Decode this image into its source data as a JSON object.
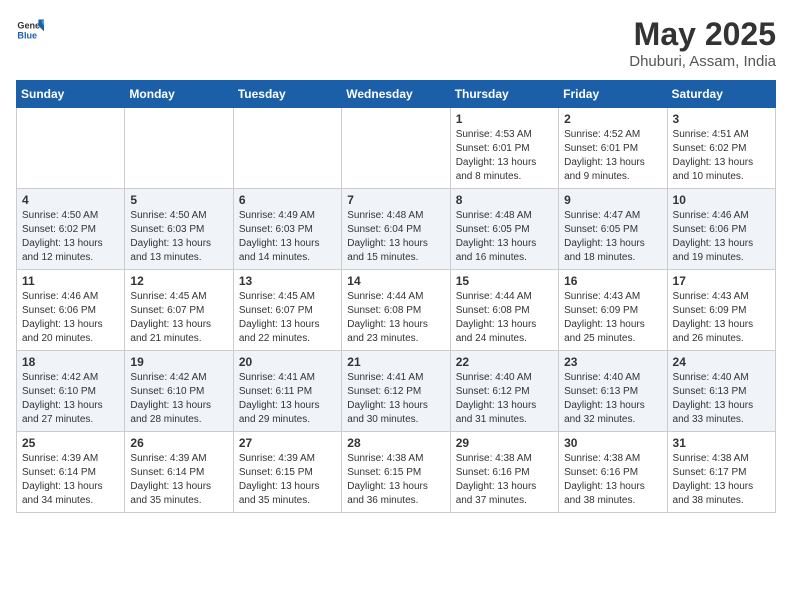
{
  "logo": {
    "general": "General",
    "blue": "Blue"
  },
  "header": {
    "month_year": "May 2025",
    "location": "Dhuburi, Assam, India"
  },
  "weekdays": [
    "Sunday",
    "Monday",
    "Tuesday",
    "Wednesday",
    "Thursday",
    "Friday",
    "Saturday"
  ],
  "weeks": [
    [
      {
        "day": "",
        "info": ""
      },
      {
        "day": "",
        "info": ""
      },
      {
        "day": "",
        "info": ""
      },
      {
        "day": "",
        "info": ""
      },
      {
        "day": "1",
        "info": "Sunrise: 4:53 AM\nSunset: 6:01 PM\nDaylight: 13 hours\nand 8 minutes."
      },
      {
        "day": "2",
        "info": "Sunrise: 4:52 AM\nSunset: 6:01 PM\nDaylight: 13 hours\nand 9 minutes."
      },
      {
        "day": "3",
        "info": "Sunrise: 4:51 AM\nSunset: 6:02 PM\nDaylight: 13 hours\nand 10 minutes."
      }
    ],
    [
      {
        "day": "4",
        "info": "Sunrise: 4:50 AM\nSunset: 6:02 PM\nDaylight: 13 hours\nand 12 minutes."
      },
      {
        "day": "5",
        "info": "Sunrise: 4:50 AM\nSunset: 6:03 PM\nDaylight: 13 hours\nand 13 minutes."
      },
      {
        "day": "6",
        "info": "Sunrise: 4:49 AM\nSunset: 6:03 PM\nDaylight: 13 hours\nand 14 minutes."
      },
      {
        "day": "7",
        "info": "Sunrise: 4:48 AM\nSunset: 6:04 PM\nDaylight: 13 hours\nand 15 minutes."
      },
      {
        "day": "8",
        "info": "Sunrise: 4:48 AM\nSunset: 6:05 PM\nDaylight: 13 hours\nand 16 minutes."
      },
      {
        "day": "9",
        "info": "Sunrise: 4:47 AM\nSunset: 6:05 PM\nDaylight: 13 hours\nand 18 minutes."
      },
      {
        "day": "10",
        "info": "Sunrise: 4:46 AM\nSunset: 6:06 PM\nDaylight: 13 hours\nand 19 minutes."
      }
    ],
    [
      {
        "day": "11",
        "info": "Sunrise: 4:46 AM\nSunset: 6:06 PM\nDaylight: 13 hours\nand 20 minutes."
      },
      {
        "day": "12",
        "info": "Sunrise: 4:45 AM\nSunset: 6:07 PM\nDaylight: 13 hours\nand 21 minutes."
      },
      {
        "day": "13",
        "info": "Sunrise: 4:45 AM\nSunset: 6:07 PM\nDaylight: 13 hours\nand 22 minutes."
      },
      {
        "day": "14",
        "info": "Sunrise: 4:44 AM\nSunset: 6:08 PM\nDaylight: 13 hours\nand 23 minutes."
      },
      {
        "day": "15",
        "info": "Sunrise: 4:44 AM\nSunset: 6:08 PM\nDaylight: 13 hours\nand 24 minutes."
      },
      {
        "day": "16",
        "info": "Sunrise: 4:43 AM\nSunset: 6:09 PM\nDaylight: 13 hours\nand 25 minutes."
      },
      {
        "day": "17",
        "info": "Sunrise: 4:43 AM\nSunset: 6:09 PM\nDaylight: 13 hours\nand 26 minutes."
      }
    ],
    [
      {
        "day": "18",
        "info": "Sunrise: 4:42 AM\nSunset: 6:10 PM\nDaylight: 13 hours\nand 27 minutes."
      },
      {
        "day": "19",
        "info": "Sunrise: 4:42 AM\nSunset: 6:10 PM\nDaylight: 13 hours\nand 28 minutes."
      },
      {
        "day": "20",
        "info": "Sunrise: 4:41 AM\nSunset: 6:11 PM\nDaylight: 13 hours\nand 29 minutes."
      },
      {
        "day": "21",
        "info": "Sunrise: 4:41 AM\nSunset: 6:12 PM\nDaylight: 13 hours\nand 30 minutes."
      },
      {
        "day": "22",
        "info": "Sunrise: 4:40 AM\nSunset: 6:12 PM\nDaylight: 13 hours\nand 31 minutes."
      },
      {
        "day": "23",
        "info": "Sunrise: 4:40 AM\nSunset: 6:13 PM\nDaylight: 13 hours\nand 32 minutes."
      },
      {
        "day": "24",
        "info": "Sunrise: 4:40 AM\nSunset: 6:13 PM\nDaylight: 13 hours\nand 33 minutes."
      }
    ],
    [
      {
        "day": "25",
        "info": "Sunrise: 4:39 AM\nSunset: 6:14 PM\nDaylight: 13 hours\nand 34 minutes."
      },
      {
        "day": "26",
        "info": "Sunrise: 4:39 AM\nSunset: 6:14 PM\nDaylight: 13 hours\nand 35 minutes."
      },
      {
        "day": "27",
        "info": "Sunrise: 4:39 AM\nSunset: 6:15 PM\nDaylight: 13 hours\nand 35 minutes."
      },
      {
        "day": "28",
        "info": "Sunrise: 4:38 AM\nSunset: 6:15 PM\nDaylight: 13 hours\nand 36 minutes."
      },
      {
        "day": "29",
        "info": "Sunrise: 4:38 AM\nSunset: 6:16 PM\nDaylight: 13 hours\nand 37 minutes."
      },
      {
        "day": "30",
        "info": "Sunrise: 4:38 AM\nSunset: 6:16 PM\nDaylight: 13 hours\nand 38 minutes."
      },
      {
        "day": "31",
        "info": "Sunrise: 4:38 AM\nSunset: 6:17 PM\nDaylight: 13 hours\nand 38 minutes."
      }
    ]
  ]
}
